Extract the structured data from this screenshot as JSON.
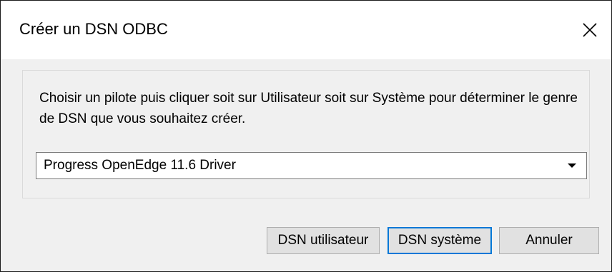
{
  "window": {
    "title": "Créer un DSN ODBC",
    "close_icon": "close-icon"
  },
  "content": {
    "description": "Choisir un pilote puis cliquer soit sur Utilisateur soit sur Système pour déterminer le genre de DSN que vous souhaitez créer.",
    "driver_select": {
      "selected": "Progress OpenEdge 11.6 Driver",
      "icon": "chevron-down-icon"
    }
  },
  "buttons": {
    "user_dsn": "DSN utilisateur",
    "system_dsn": "DSN système",
    "cancel": "Annuler"
  },
  "colors": {
    "accent": "#0078d7",
    "dialog_bg": "#f0f0f0",
    "button_bg": "#e1e1e1"
  }
}
